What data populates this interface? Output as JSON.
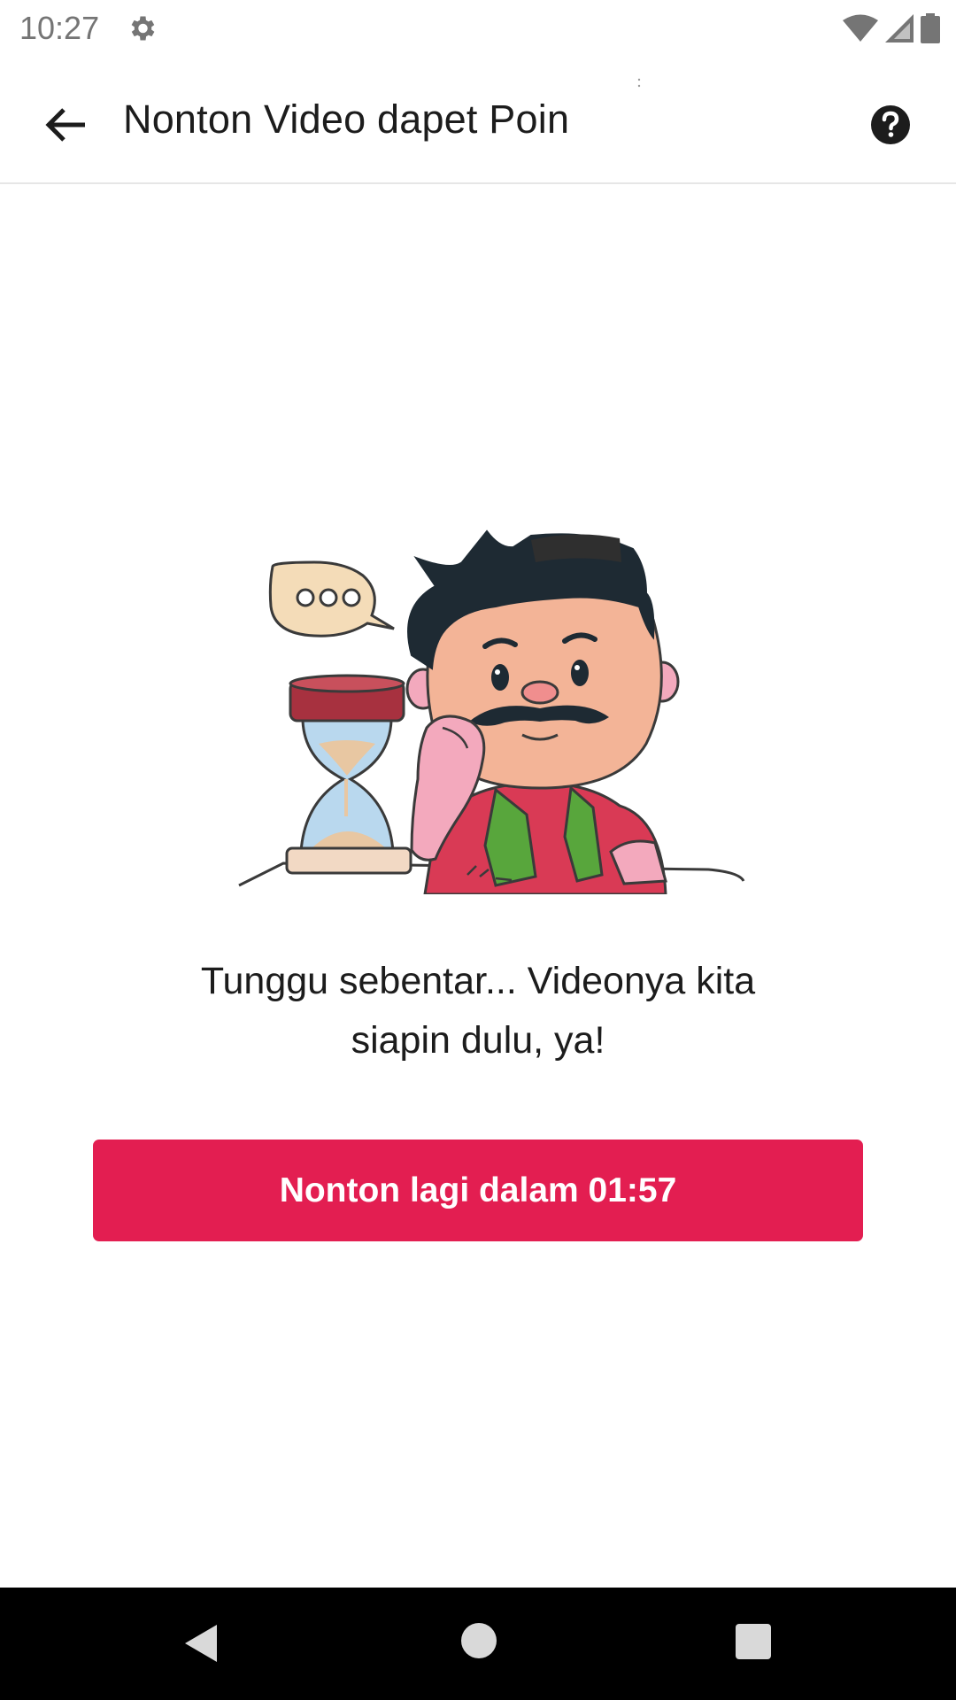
{
  "status_bar": {
    "time": "10:27",
    "icons": [
      "settings-gear-icon",
      "wifi-icon",
      "cellular-signal-icon",
      "battery-icon"
    ]
  },
  "app_bar": {
    "title": "Nonton Video dapet Poin",
    "back_icon": "arrow-left-icon",
    "help_icon": "help-circle-icon"
  },
  "content": {
    "illustration": "waiting-character-hourglass",
    "message_line1": "Tunggu sebentar... Videonya kita",
    "message_line2": "siapin dulu, ya!",
    "button_label": "Nonton lagi dalam 01:57"
  },
  "colors": {
    "accent": "#e31e51",
    "text": "#1c1c1c",
    "status_text": "#757575",
    "nav_bg": "#000000"
  },
  "nav_bar": {
    "icons": [
      "nav-back-icon",
      "nav-home-icon",
      "nav-recents-icon"
    ]
  }
}
